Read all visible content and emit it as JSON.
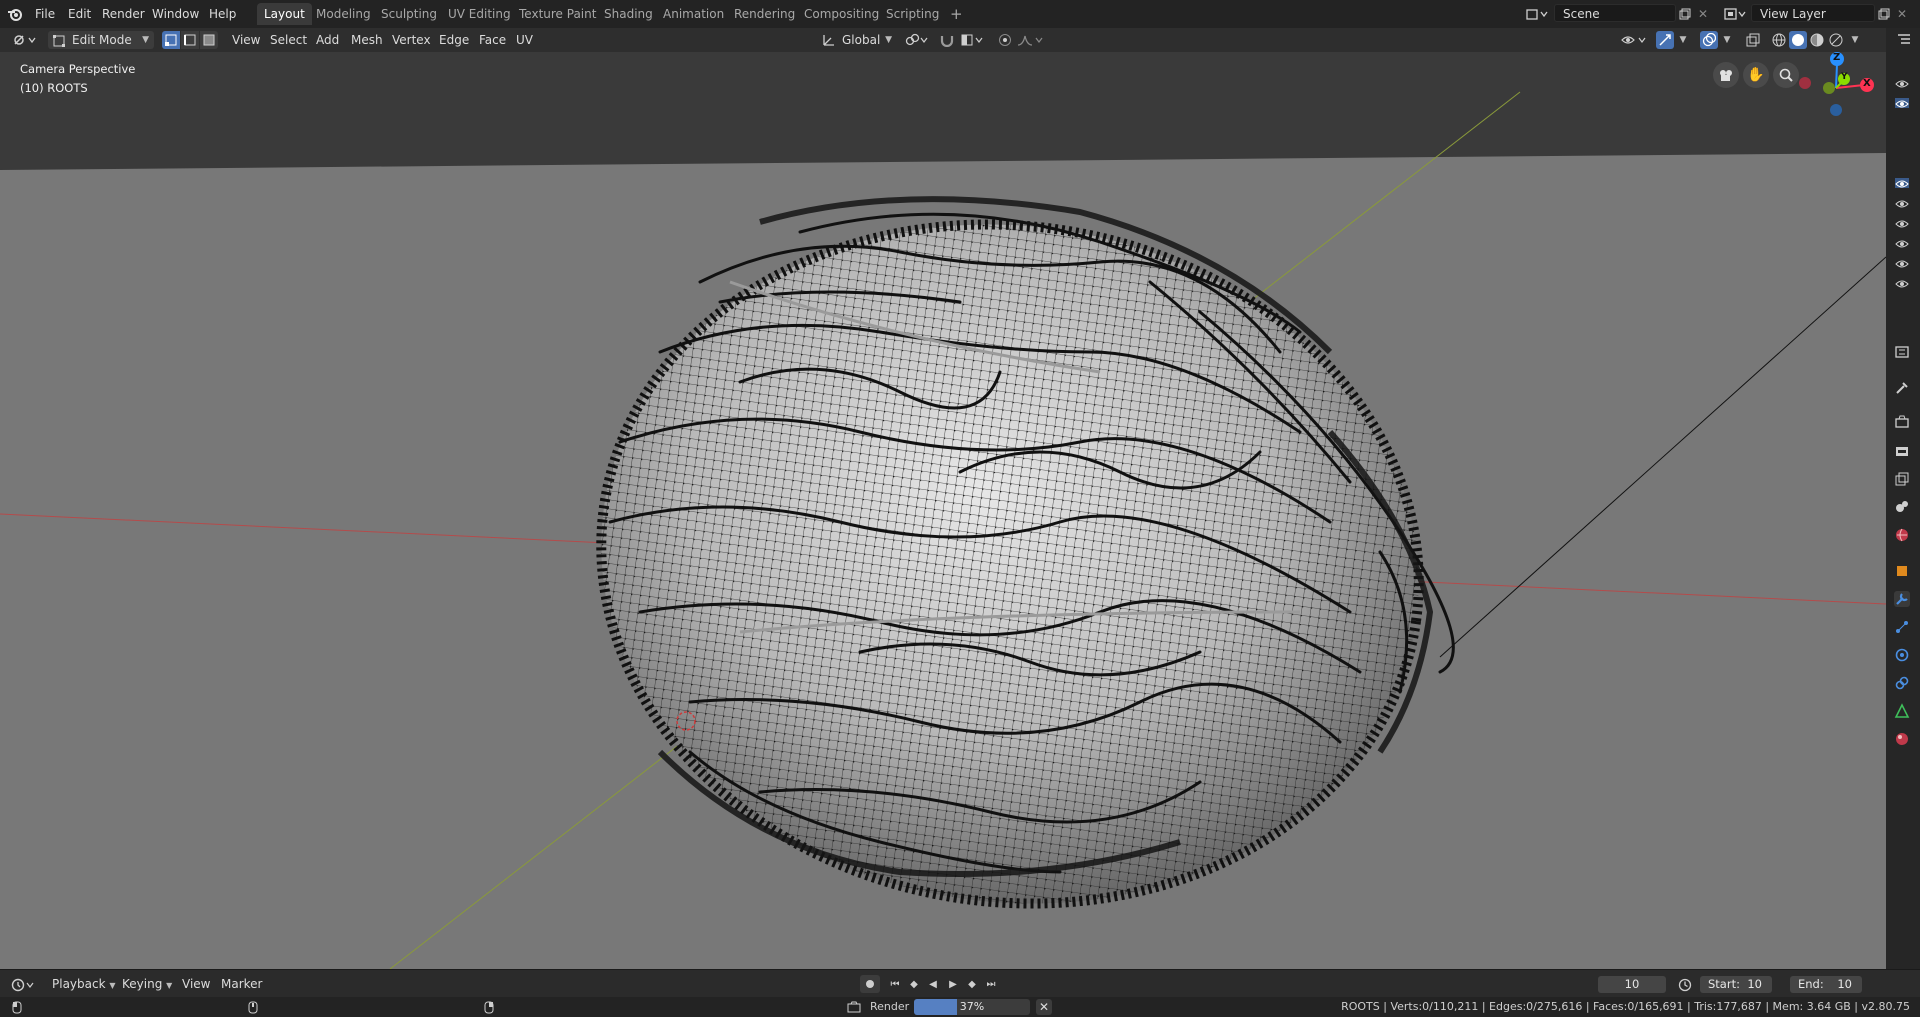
{
  "menu": {
    "items": [
      "File",
      "Edit",
      "Render",
      "Window",
      "Help"
    ]
  },
  "workspaces": {
    "tabs": [
      "Layout",
      "Modeling",
      "Sculpting",
      "UV Editing",
      "Texture Paint",
      "Shading",
      "Animation",
      "Rendering",
      "Compositing",
      "Scripting"
    ],
    "active": "Layout",
    "add_label": "+"
  },
  "scene": {
    "name": "Scene",
    "view_layer": "View Layer"
  },
  "header": {
    "mode": "Edit Mode",
    "menus": [
      "View",
      "Select",
      "Add",
      "Mesh",
      "Vertex",
      "Edge",
      "Face",
      "UV"
    ],
    "transform_orientation": "Global"
  },
  "viewport": {
    "camera_label": "Camera Perspective",
    "object_label": "(10) ROOTS",
    "gizmo": {
      "z": "Z",
      "y": "Y",
      "x": "X"
    }
  },
  "timeline": {
    "menus": [
      "Playback",
      "Keying",
      "View",
      "Marker"
    ],
    "current_frame": "10",
    "start_label": "Start:",
    "start_value": "10",
    "end_label": "End:",
    "end_value": "10"
  },
  "statusbar": {
    "render_label": "Render",
    "progress_text": "37%",
    "progress": 0.37,
    "stats": "ROOTS | Verts:0/110,211 | Edges:0/275,616 | Faces:0/165,691 | Tris:177,687 | Mem: 3.64 GB | v2.80.75"
  },
  "colors": {
    "accent": "#4772b3",
    "x_axis": "#ff3352",
    "y_axis": "#8bdc00",
    "z_axis": "#2890ff",
    "viewport_bg": "#787878"
  }
}
